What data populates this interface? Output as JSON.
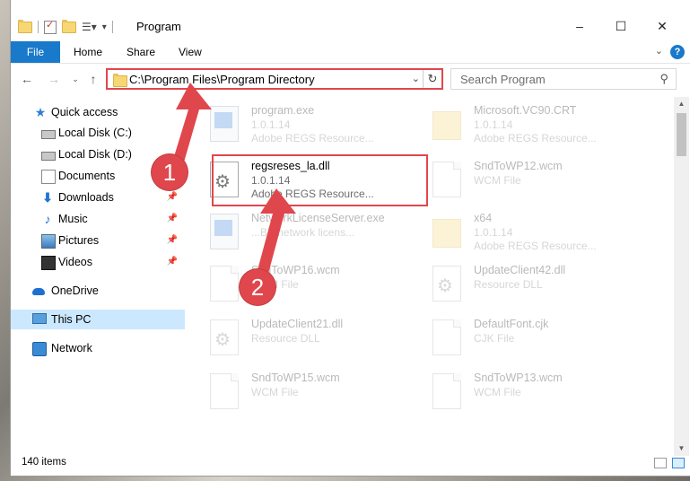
{
  "window": {
    "title": "Program",
    "controls": {
      "minimize": "–",
      "maximize": "☐",
      "close": "✕"
    }
  },
  "ribbon": {
    "tabs": [
      "File",
      "Home",
      "Share",
      "View"
    ],
    "help": "?"
  },
  "address": {
    "path": "C:\\Program Files\\Program Directory",
    "search_placeholder": "Search Program"
  },
  "sidebar": {
    "items": [
      {
        "label": "Quick access",
        "icon": "star-icon"
      },
      {
        "label": "Local Disk (C:)",
        "icon": "drive-icon"
      },
      {
        "label": "Local Disk (D:)",
        "icon": "drive-icon"
      },
      {
        "label": "Documents",
        "icon": "documents-icon"
      },
      {
        "label": "Downloads",
        "icon": "downloads-icon"
      },
      {
        "label": "Music",
        "icon": "music-icon"
      },
      {
        "label": "Pictures",
        "icon": "pictures-icon"
      },
      {
        "label": "Videos",
        "icon": "videos-icon"
      },
      {
        "label": "OneDrive",
        "icon": "onedrive-icon"
      },
      {
        "label": "This PC",
        "icon": "this-pc-icon"
      },
      {
        "label": "Network",
        "icon": "network-icon"
      }
    ]
  },
  "files": [
    {
      "name": "program.exe",
      "version": "1.0.1.14",
      "description": "Adobe REGS Resource..."
    },
    {
      "name": "Microsoft.VC90.CRT",
      "version": "1.0.1.14",
      "description": "Adobe REGS Resource..."
    },
    {
      "name": "regsreses_la.dll",
      "version": "1.0.1.14",
      "description": "Adobe REGS Resource..."
    },
    {
      "name": "SndToWP12.wcm",
      "version": "WCM File",
      "description": ""
    },
    {
      "name": "NetworkLicenseServer.exe",
      "version": "...BY network licens...",
      "description": ""
    },
    {
      "name": "x64",
      "version": "1.0.1.14",
      "description": "Adobe REGS Resource..."
    },
    {
      "name": "SndToWP16.wcm",
      "version": "WCM File",
      "description": ""
    },
    {
      "name": "UpdateClient42.dll",
      "version": "Resource DLL",
      "description": ""
    },
    {
      "name": "UpdateClient21.dll",
      "version": "Resource DLL",
      "description": ""
    },
    {
      "name": "DefaultFont.cjk",
      "version": "CJK File",
      "description": ""
    },
    {
      "name": "SndToWP15.wcm",
      "version": "WCM File",
      "description": ""
    },
    {
      "name": "SndToWP13.wcm",
      "version": "WCM File",
      "description": ""
    }
  ],
  "status": {
    "items_count": "140 items"
  },
  "callouts": {
    "one": "1",
    "two": "2"
  },
  "colors": {
    "accent": "#1979ca",
    "highlight": "#e0474c",
    "selection": "#cce8ff"
  }
}
